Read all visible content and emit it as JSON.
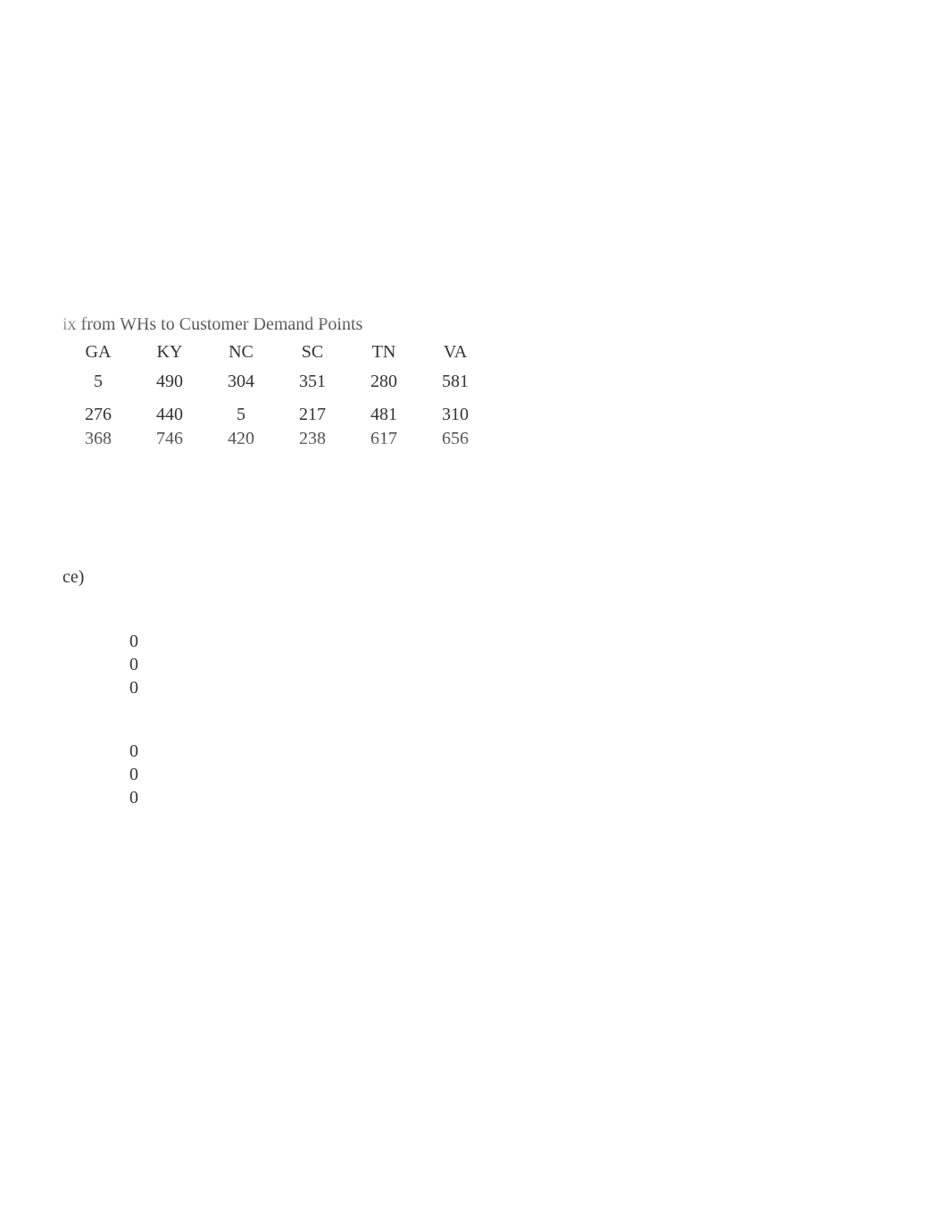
{
  "table": {
    "title": "ix from WHs to Customer Demand Points",
    "headers": [
      "GA",
      "KY",
      "NC",
      "SC",
      "TN",
      "VA"
    ],
    "rows": [
      [
        "5",
        "490",
        "304",
        "351",
        "280",
        "581"
      ],
      [
        "276",
        "440",
        "5",
        "217",
        "481",
        "310"
      ],
      [
        "368",
        "746",
        "420",
        "238",
        "617",
        "656"
      ]
    ]
  },
  "fragment": "ce)",
  "zeros": {
    "group1": [
      "0",
      "0",
      "0"
    ],
    "group2": [
      "0",
      "0",
      "0"
    ]
  }
}
